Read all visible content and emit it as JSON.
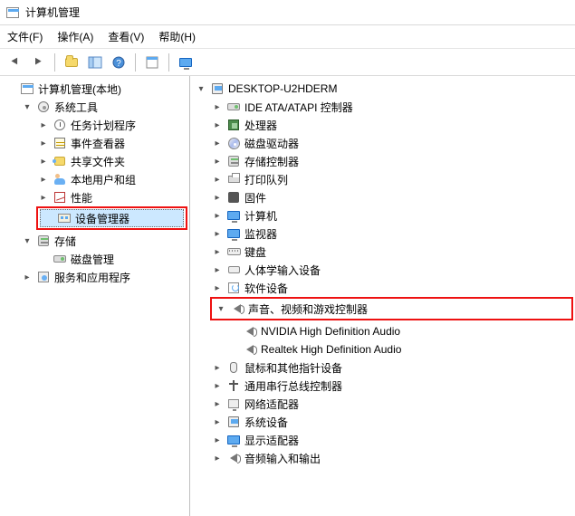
{
  "window": {
    "title": "计算机管理"
  },
  "menu": {
    "file": "文件(F)",
    "action": "操作(A)",
    "view": "查看(V)",
    "help": "帮助(H)"
  },
  "left": {
    "root": "计算机管理(本地)",
    "system_tools": "系统工具",
    "task_scheduler": "任务计划程序",
    "event_viewer": "事件查看器",
    "shared_folders": "共享文件夹",
    "local_users": "本地用户和组",
    "performance": "性能",
    "device_manager": "设备管理器",
    "storage": "存储",
    "disk_mgmt": "磁盘管理",
    "services_apps": "服务和应用程序"
  },
  "right": {
    "host": "DESKTOP-U2HDERM",
    "ide": "IDE ATA/ATAPI 控制器",
    "cpu": "处理器",
    "cdrom": "磁盘驱动器",
    "storage_ctrl": "存储控制器",
    "print_queue": "打印队列",
    "firmware": "固件",
    "computer": "计算机",
    "monitor": "监视器",
    "keyboard": "键盘",
    "hid": "人体学输入设备",
    "software": "软件设备",
    "sound": "声音、视频和游戏控制器",
    "sound_child1": "NVIDIA High Definition Audio",
    "sound_child2": "Realtek High Definition Audio",
    "mouse": "鼠标和其他指针设备",
    "usb": "通用串行总线控制器",
    "net": "网络适配器",
    "sysdev": "系统设备",
    "display": "显示适配器",
    "audio_io": "音频输入和输出"
  }
}
